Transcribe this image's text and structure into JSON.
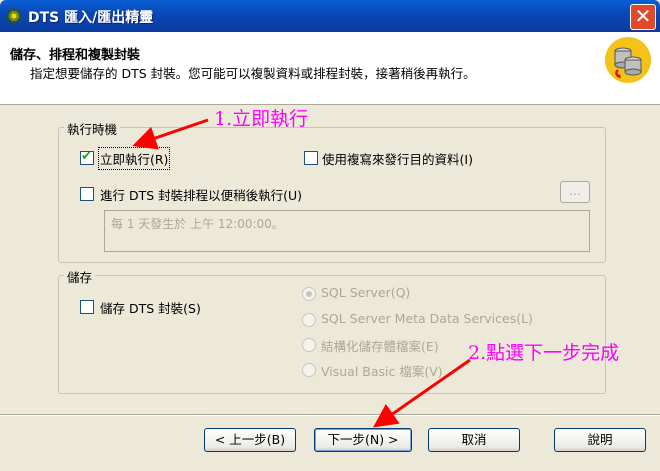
{
  "window": {
    "title": "DTS 匯入/匯出精靈",
    "close_glyph": "✕"
  },
  "header": {
    "title": "儲存、排程和複製封裝",
    "subtitle": "指定想要儲存的 DTS 封裝。您可能可以複製資料或排程封裝，接著稍後再執行。"
  },
  "run_group": {
    "label": "執行時機",
    "run_now": {
      "label": "立即執行(R)",
      "checked": true
    },
    "use_replication": {
      "label": "使用複寫來發行目的資料(I)",
      "checked": false
    },
    "schedule": {
      "label": "進行 DTS 封裝排程以便稍後執行(U)",
      "checked": false
    },
    "schedule_button": "...",
    "schedule_text": "每 1 天發生於 上午 12:00:00。"
  },
  "save_group": {
    "label": "儲存",
    "save_package": {
      "label": "儲存 DTS 封裝(S)",
      "checked": false
    },
    "options": [
      {
        "label": "SQL Server(Q)",
        "selected": true
      },
      {
        "label": "SQL Server Meta Data Services(L)",
        "selected": false
      },
      {
        "label": "結構化儲存體檔案(E)",
        "selected": false
      },
      {
        "label": "Visual Basic 檔案(V)",
        "selected": false
      }
    ]
  },
  "buttons": {
    "back": "< 上一步(B)",
    "next": "下一步(N) >",
    "cancel": "取消",
    "help": "說明"
  },
  "annotations": {
    "step1": "1.立即執行",
    "step2": "2.點選下一步完成",
    "color": "#ff00ff"
  },
  "colors": {
    "titlebar": "#0a4fc8",
    "face": "#ece9d8",
    "check": "#21a121"
  }
}
